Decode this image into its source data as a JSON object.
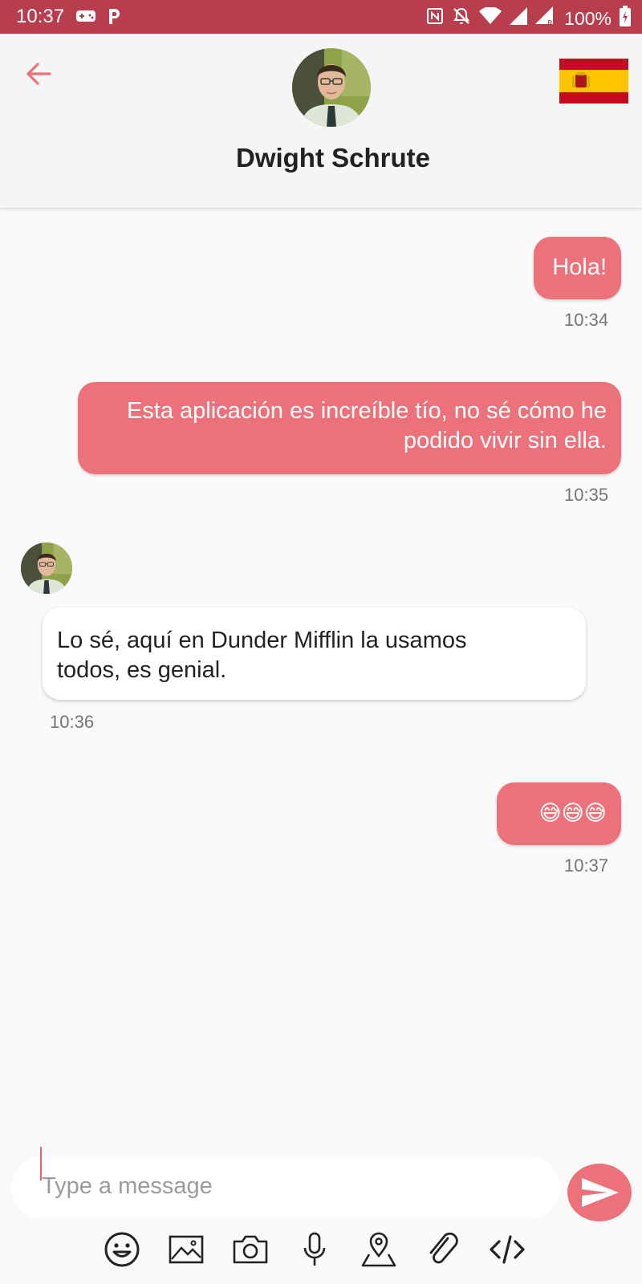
{
  "status_bar": {
    "time": "10:37",
    "battery": "100%"
  },
  "header": {
    "contact_name": "Dwight Schrute"
  },
  "messages": [
    {
      "direction": "out",
      "text": "Hola!",
      "time": "10:34"
    },
    {
      "direction": "out",
      "text": "Esta aplicación es increíble tío, no sé cómo he podido vivir sin ella.",
      "time": "10:35"
    },
    {
      "direction": "in",
      "text": "Lo sé, aquí en Dunder Mifflin la usamos todos, es genial.",
      "time": "10:36"
    },
    {
      "direction": "out",
      "text": "😅😅😅",
      "time": "10:37"
    }
  ],
  "composer": {
    "placeholder": "Type a message",
    "value": ""
  },
  "toolbar": [
    "emoji-icon",
    "image-icon",
    "camera-icon",
    "microphone-icon",
    "location-icon",
    "attachment-icon",
    "code-icon"
  ],
  "colors": {
    "accent": "#ec717a",
    "status_bar": "#b83e4e",
    "background": "#f9f9f9"
  }
}
